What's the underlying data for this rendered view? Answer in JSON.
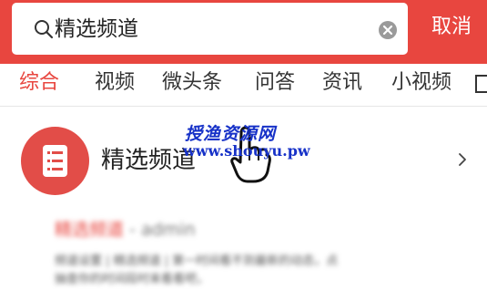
{
  "search": {
    "query": "精选频道",
    "cancel_label": "取消"
  },
  "tabs": [
    {
      "label": "综合",
      "active": true
    },
    {
      "label": "视频"
    },
    {
      "label": "微头条"
    },
    {
      "label": "问答"
    },
    {
      "label": "资讯"
    },
    {
      "label": "小视频"
    }
  ],
  "channel": {
    "title": "精选频道"
  },
  "watermark": {
    "cn": "授渔资源网",
    "url": "www.shouyu.pw"
  },
  "result": {
    "title_highlight": "精选频道",
    "title_separator": " - ",
    "title_author": "admin",
    "snippet_line1": "频道设置 | 精选频道 | 第一时间看不到最新的动态，点",
    "snippet_line2": "抽查你的时间段时来看看吧，"
  },
  "colors": {
    "brand": "#e8463f",
    "watermark": "#1732c8"
  }
}
